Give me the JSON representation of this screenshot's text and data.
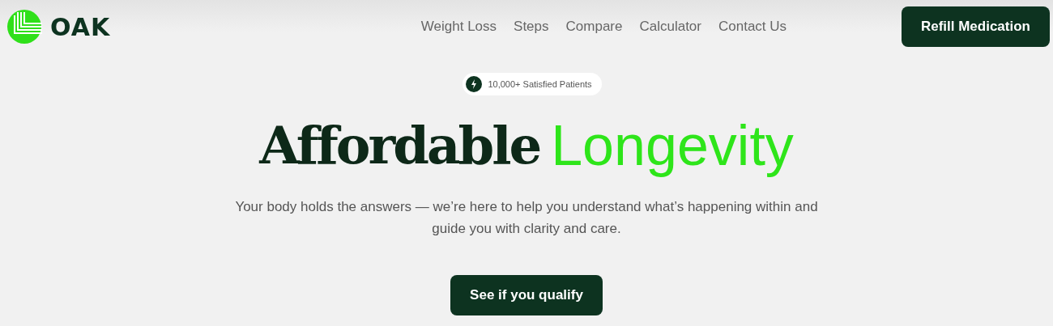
{
  "logo": {
    "text": "OAK"
  },
  "nav": [
    "Weight Loss",
    "Steps",
    "Compare",
    "Calculator",
    "Contact Us"
  ],
  "header_button": "Refill Medication",
  "badge": "10,000+ Satisfied Patients",
  "headline": [
    {
      "text": "Affordable",
      "kind": "serif"
    },
    {
      "text": "Longevity",
      "kind": "accent"
    }
  ],
  "subtitle": "Your body holds the answers — we’re here to help you understand what’s happening within and guide you with clarity and care.",
  "cta": "See if you qualify"
}
